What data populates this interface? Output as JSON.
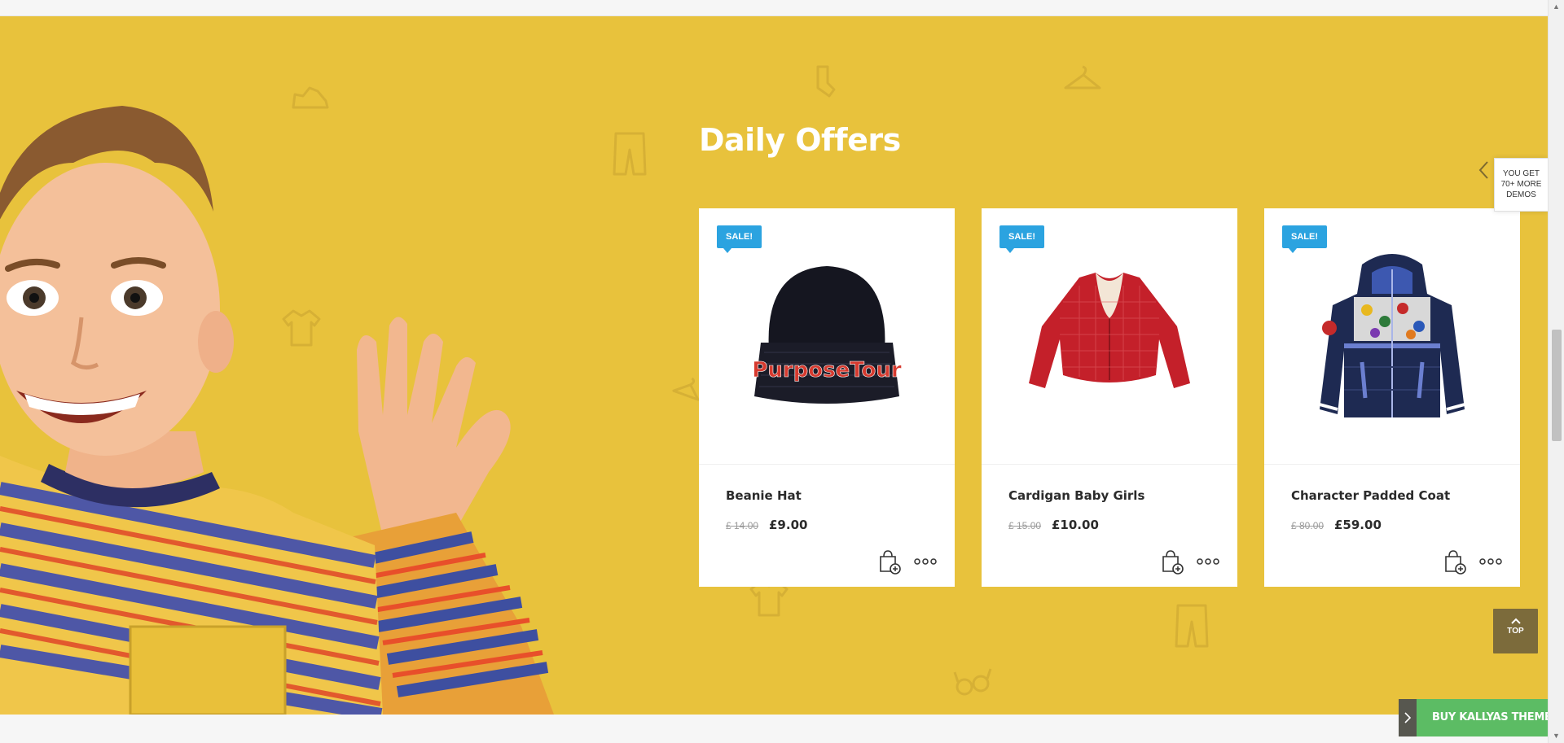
{
  "section": {
    "heading": "Daily Offers",
    "background_color": "#e8c23c"
  },
  "products": [
    {
      "badge": "SALE!",
      "name": "Beanie Hat",
      "old_price": "£ 14.00",
      "new_price": "£9.00",
      "image_icon": "beanie-hat"
    },
    {
      "badge": "SALE!",
      "name": "Cardigan Baby Girls",
      "old_price": "£ 15.00",
      "new_price": "£10.00",
      "image_icon": "red-cardigan"
    },
    {
      "badge": "SALE!",
      "name": "Character Padded Coat",
      "old_price": "£ 80.00",
      "new_price": "£59.00",
      "image_icon": "padded-coat"
    }
  ],
  "card_actions": {
    "cart_icon": "add-to-cart-icon",
    "more_icon": "more-options-icon"
  },
  "demos_tab": {
    "line1": "YOU GET",
    "line2": "70+ MORE",
    "line3": "DEMOS"
  },
  "top_button": {
    "label": "TOP"
  },
  "buy_bar": {
    "label": "BUY KALLYAS THEME",
    "color": "#5cbc64"
  },
  "badge_color": "#2ba3e0",
  "decor_icons": [
    "shoe-icon",
    "sock-icon",
    "hanger-icon",
    "pants-icon",
    "tshirt-icon",
    "glasses-icon"
  ]
}
